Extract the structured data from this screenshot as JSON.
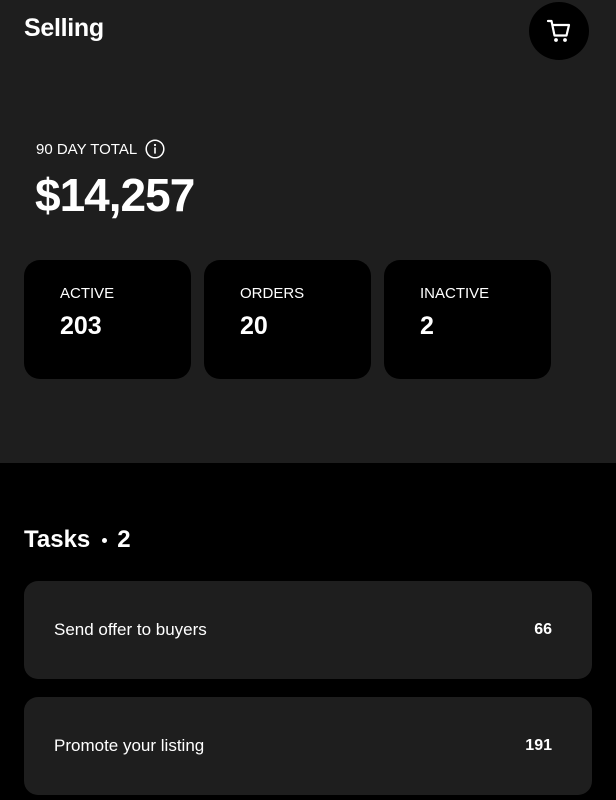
{
  "header": {
    "title": "Selling",
    "cart_icon": "shopping-cart-icon"
  },
  "summary": {
    "label": "90 DAY TOTAL",
    "info_icon": "info-icon",
    "value": "$14,257"
  },
  "stats": [
    {
      "label": "ACTIVE",
      "value": "203"
    },
    {
      "label": "ORDERS",
      "value": "20"
    },
    {
      "label": "INACTIVE",
      "value": "2"
    }
  ],
  "tasks": {
    "title": "Tasks",
    "count": "2",
    "items": [
      {
        "label": "Send offer to buyers",
        "count": "66"
      },
      {
        "label": "Promote your listing",
        "count": "191"
      }
    ]
  },
  "colors": {
    "top_background": "#1e1e1e",
    "page_background": "#000000",
    "card_background": "#000000",
    "task_card_background": "#1e1e1e",
    "text": "#ffffff"
  }
}
